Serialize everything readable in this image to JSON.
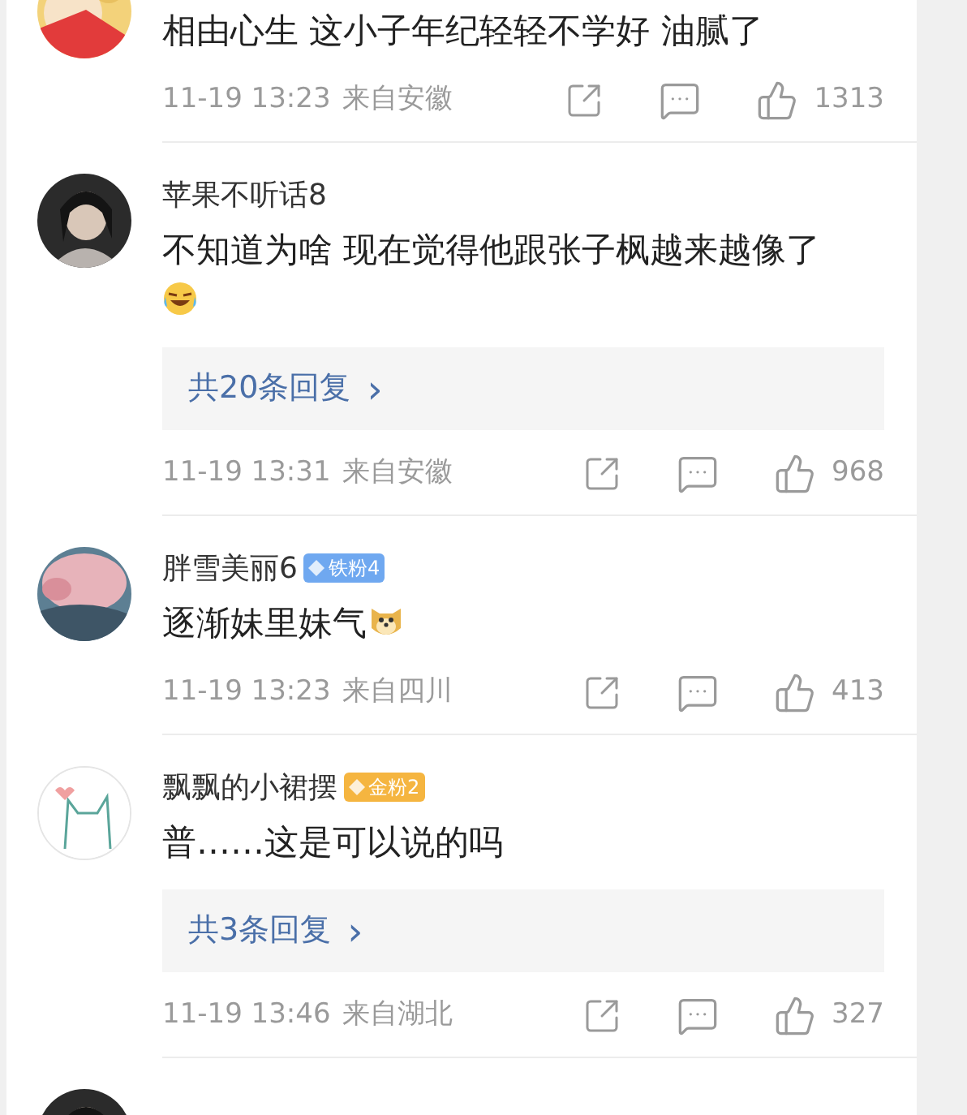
{
  "comments": [
    {
      "text": "相由心生 这小子年纪轻轻不学好 油腻了",
      "meta": {
        "time": "11-19 13:23",
        "location": "来自安徽",
        "likes": "1313"
      },
      "avatar": {
        "kind": "picture"
      }
    },
    {
      "name": "苹果不听话8",
      "text": "不知道为啥 现在觉得他跟张子枫越来越像了",
      "emoji": {
        "kind": "laugh"
      },
      "reply": {
        "label": "共20条回复",
        "arrow": "›"
      },
      "meta": {
        "time": "11-19 13:31",
        "location": "来自安徽",
        "likes": "968"
      },
      "avatar": {
        "kind": "picture"
      }
    },
    {
      "name": "胖雪美丽6",
      "badge": {
        "label": "铁粉4",
        "color": "#6fa8f0"
      },
      "text": "逐渐妹里妹气",
      "emoji": {
        "kind": "dog"
      },
      "meta": {
        "time": "11-19 13:23",
        "location": "来自四川",
        "likes": "413"
      },
      "avatar": {
        "kind": "picture"
      }
    },
    {
      "name": "飘飘的小裙摆",
      "badge": {
        "label": "金粉2",
        "color": "#f5b540"
      },
      "text": "普……这是可以说的吗",
      "reply": {
        "label": "共3条回复",
        "arrow": "›"
      },
      "meta": {
        "time": "11-19 13:46",
        "location": "来自湖北",
        "likes": "327"
      },
      "avatar": {
        "kind": "picture"
      }
    },
    {
      "avatar": {
        "kind": "picture"
      }
    }
  ]
}
